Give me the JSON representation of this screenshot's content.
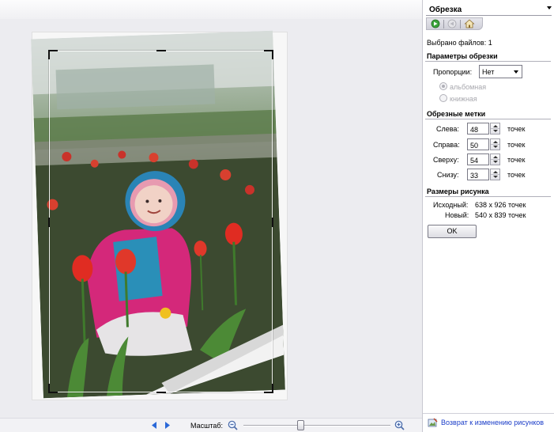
{
  "panel": {
    "title": "Обрезка",
    "selected_files": "Выбрано файлов: 1"
  },
  "crop_params": {
    "section_title": "Параметры обрезки",
    "proportions_label": "Пропорции:",
    "proportions_value": "Нет",
    "landscape_label": "альбомная",
    "portrait_label": "книжная"
  },
  "crop_marks": {
    "section_title": "Обрезные метки",
    "left_label": "Слева:",
    "left_value": "48",
    "right_label": "Справа:",
    "right_value": "50",
    "top_label": "Сверху:",
    "top_value": "54",
    "bottom_label": "Снизу:",
    "bottom_value": "33",
    "unit": "точек"
  },
  "image_size": {
    "section_title": "Размеры рисунка",
    "original_label": "Исходный:",
    "original_value": "638 x 926 точек",
    "new_label": "Новый:",
    "new_value": "540 x 839 точек"
  },
  "ok_label": "OK",
  "back_link": "Возврат к изменению рисунков",
  "zoom": {
    "label": "Масштаб:",
    "level": 0.39
  },
  "icons": {
    "toolbar": [
      "go-forward-icon",
      "go-back-icon",
      "home-icon"
    ],
    "navigation": [
      "prev-arrow-icon",
      "next-arrow-icon"
    ],
    "zoom": [
      "zoom-out-icon",
      "zoom-in-icon"
    ],
    "back": "edit-picture-icon"
  }
}
